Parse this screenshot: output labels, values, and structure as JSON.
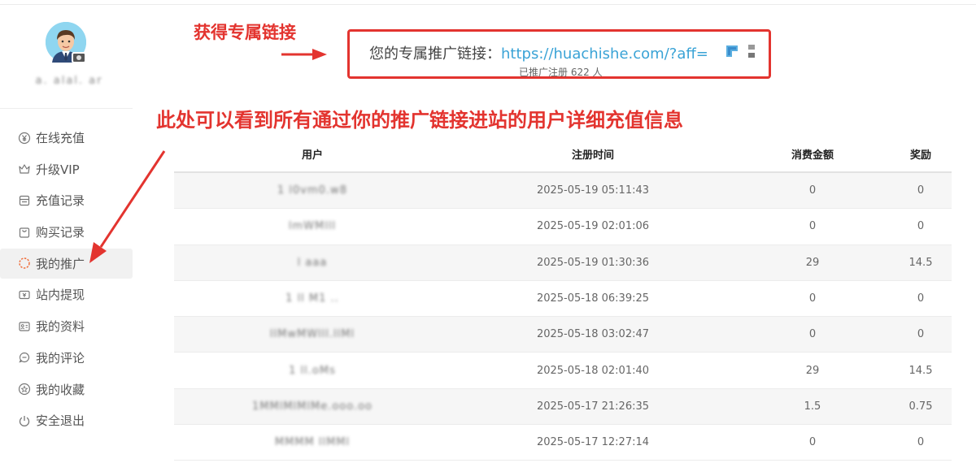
{
  "sidebar": {
    "username": "a. alal. ar",
    "items": [
      {
        "label": "在线充值",
        "icon": "yen-circle-icon"
      },
      {
        "label": "升级VIP",
        "icon": "crown-icon"
      },
      {
        "label": "充值记录",
        "icon": "ledger-icon"
      },
      {
        "label": "购买记录",
        "icon": "shopping-bag-icon"
      },
      {
        "label": "我的推广",
        "icon": "spinner-icon",
        "active": true
      },
      {
        "label": "站内提现",
        "icon": "ticket-icon"
      },
      {
        "label": "我的资料",
        "icon": "id-card-icon"
      },
      {
        "label": "我的评论",
        "icon": "comment-icon"
      },
      {
        "label": "我的收藏",
        "icon": "star-circle-icon"
      },
      {
        "label": "安全退出",
        "icon": "power-icon"
      }
    ]
  },
  "annotations": {
    "title": "获得专属链接",
    "description": "此处可以看到所有通过你的推广链接进站的用户详细充值信息"
  },
  "referral": {
    "label": "您的专属推广链接：",
    "url": "https://huachishe.com/?aff=",
    "registered_text": "已推广注册 622 人"
  },
  "table": {
    "headers": [
      "用户",
      "注册时间",
      "消费金额",
      "奖励"
    ],
    "rows": [
      {
        "user": "1 l0vm0.w8",
        "time": "2025-05-19 05:11:43",
        "amount": "0",
        "reward": "0"
      },
      {
        "user": "lmWMlll",
        "time": "2025-05-19 02:01:06",
        "amount": "0",
        "reward": "0"
      },
      {
        "user": "l aaa",
        "time": "2025-05-19 01:30:36",
        "amount": "29",
        "reward": "14.5"
      },
      {
        "user": "1 ll M1 ..",
        "time": "2025-05-18 06:39:25",
        "amount": "0",
        "reward": "0"
      },
      {
        "user": "llMwMWlll.llMl",
        "time": "2025-05-18 03:02:47",
        "amount": "0",
        "reward": "0"
      },
      {
        "user": "1 ll.oMs",
        "time": "2025-05-18 02:01:40",
        "amount": "29",
        "reward": "14.5"
      },
      {
        "user": "1MMlMlMlMe.ooo.oo",
        "time": "2025-05-17 21:26:35",
        "amount": "1.5",
        "reward": "0.75"
      },
      {
        "user": "MMMM llMMl",
        "time": "2025-05-17 12:27:14",
        "amount": "0",
        "reward": "0"
      }
    ]
  },
  "colors": {
    "annotation_red": "#e3342f",
    "link_blue": "#3aa3d6",
    "active_icon": "#f06a35"
  }
}
